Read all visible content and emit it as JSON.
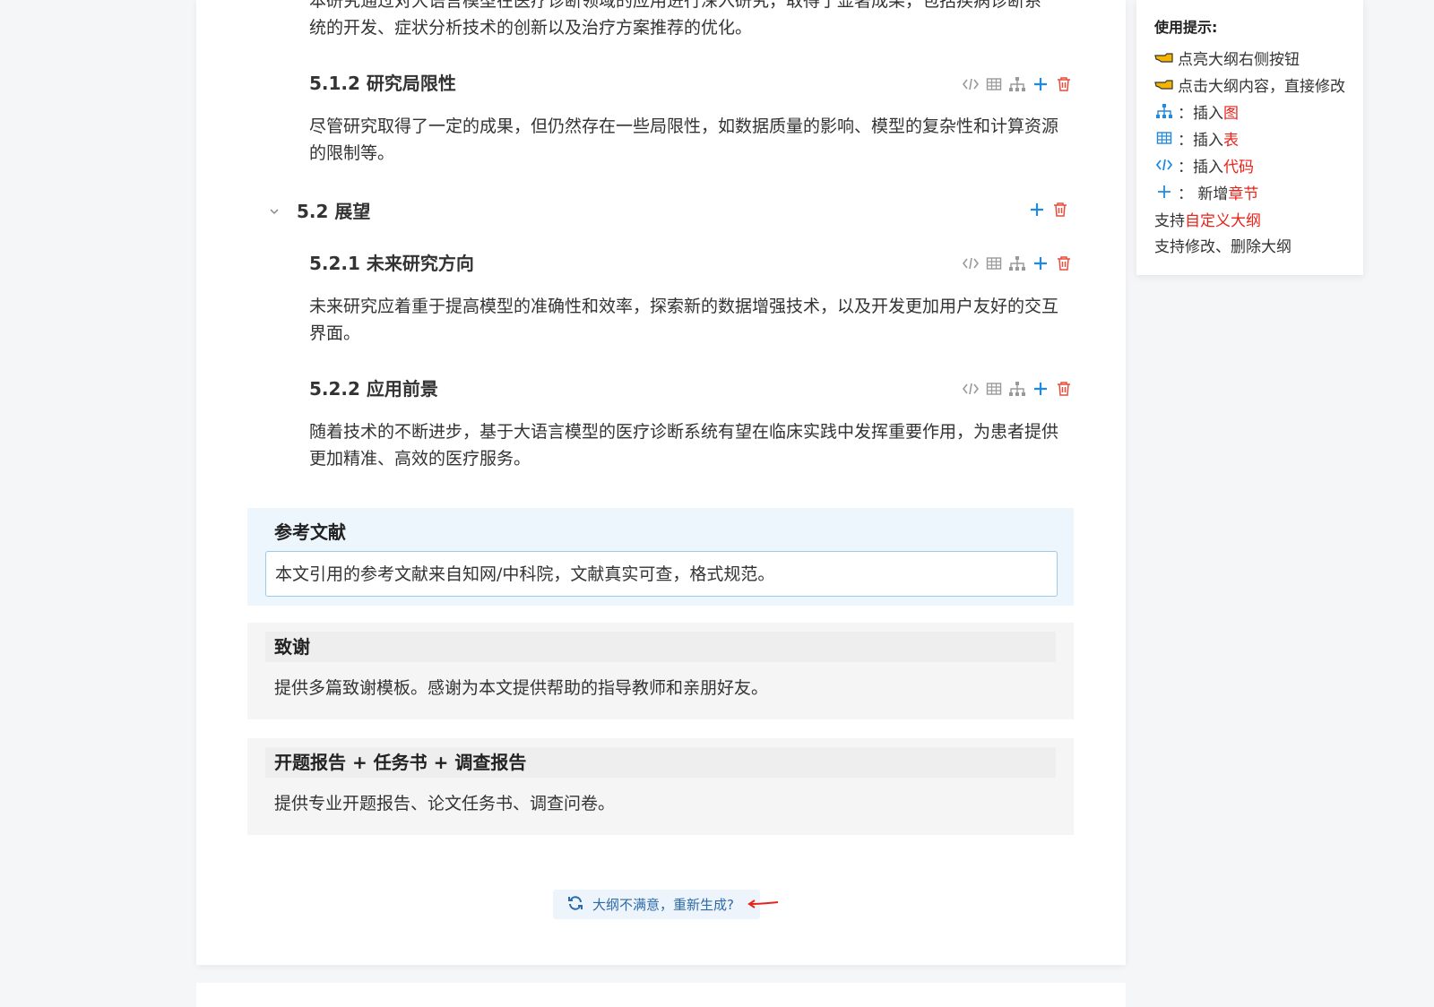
{
  "doc": {
    "intro_line1": "本研究通过对大语言模型在医疗诊断领域的应用进行深入研究，取得了显著成果，包括疾病诊断系",
    "intro_line2": "统的开发、症状分析技术的创新以及治疗方案推荐的优化。",
    "s512_title": "5.1.2 研究局限性",
    "s512_text": "尽管研究取得了一定的成果，但仍然存在一些局限性，如数据质量的影响、模型的复杂性和计算资源的限制等。",
    "s52_title": "5.2 展望",
    "s521_title": "5.2.1 未来研究方向",
    "s521_text": "未来研究应着重于提高模型的准确性和效率，探索新的数据增强技术，以及开发更加用户友好的交互界面。",
    "s522_title": "5.2.2 应用前景",
    "s522_text": "随着技术的不断进步，基于大语言模型的医疗诊断系统有望在临床实践中发挥重要作用，为患者提供更加精准、高效的医疗服务。"
  },
  "sections": {
    "references": {
      "title": "参考文献",
      "body": "本文引用的参考文献来自知网/中科院，文献真实可查，格式规范。"
    },
    "thanks": {
      "title": "致谢",
      "body": "提供多篇致谢模板。感谢为本文提供帮助的指导教师和亲朋好友。"
    },
    "report": {
      "title": "开题报告 + 任务书 + 调查报告",
      "body": "提供专业开题报告、论文任务书、调查问卷。"
    }
  },
  "regen": {
    "label": "大纲不满意，重新生成?"
  },
  "tips": {
    "title": "使用提示:",
    "r1": "点亮大纲右侧按钮",
    "r2": "点击大纲内容，直接修改",
    "r3_prefix": "：插入",
    "r3_hl": "图",
    "r4_prefix": "：插入",
    "r4_hl": "表",
    "r5_prefix": "：插入",
    "r5_hl": "代码",
    "r6_prefix": "： 新增",
    "r6_hl": "章节",
    "r7_prefix": "支持",
    "r7_hl": "自定义大纲",
    "r8": "支持修改、删除大纲"
  },
  "colors": {
    "accent": "#1f8ae0",
    "delete": "#e74c3c",
    "highlight": "#e8231a",
    "tool_gray": "#999999"
  }
}
